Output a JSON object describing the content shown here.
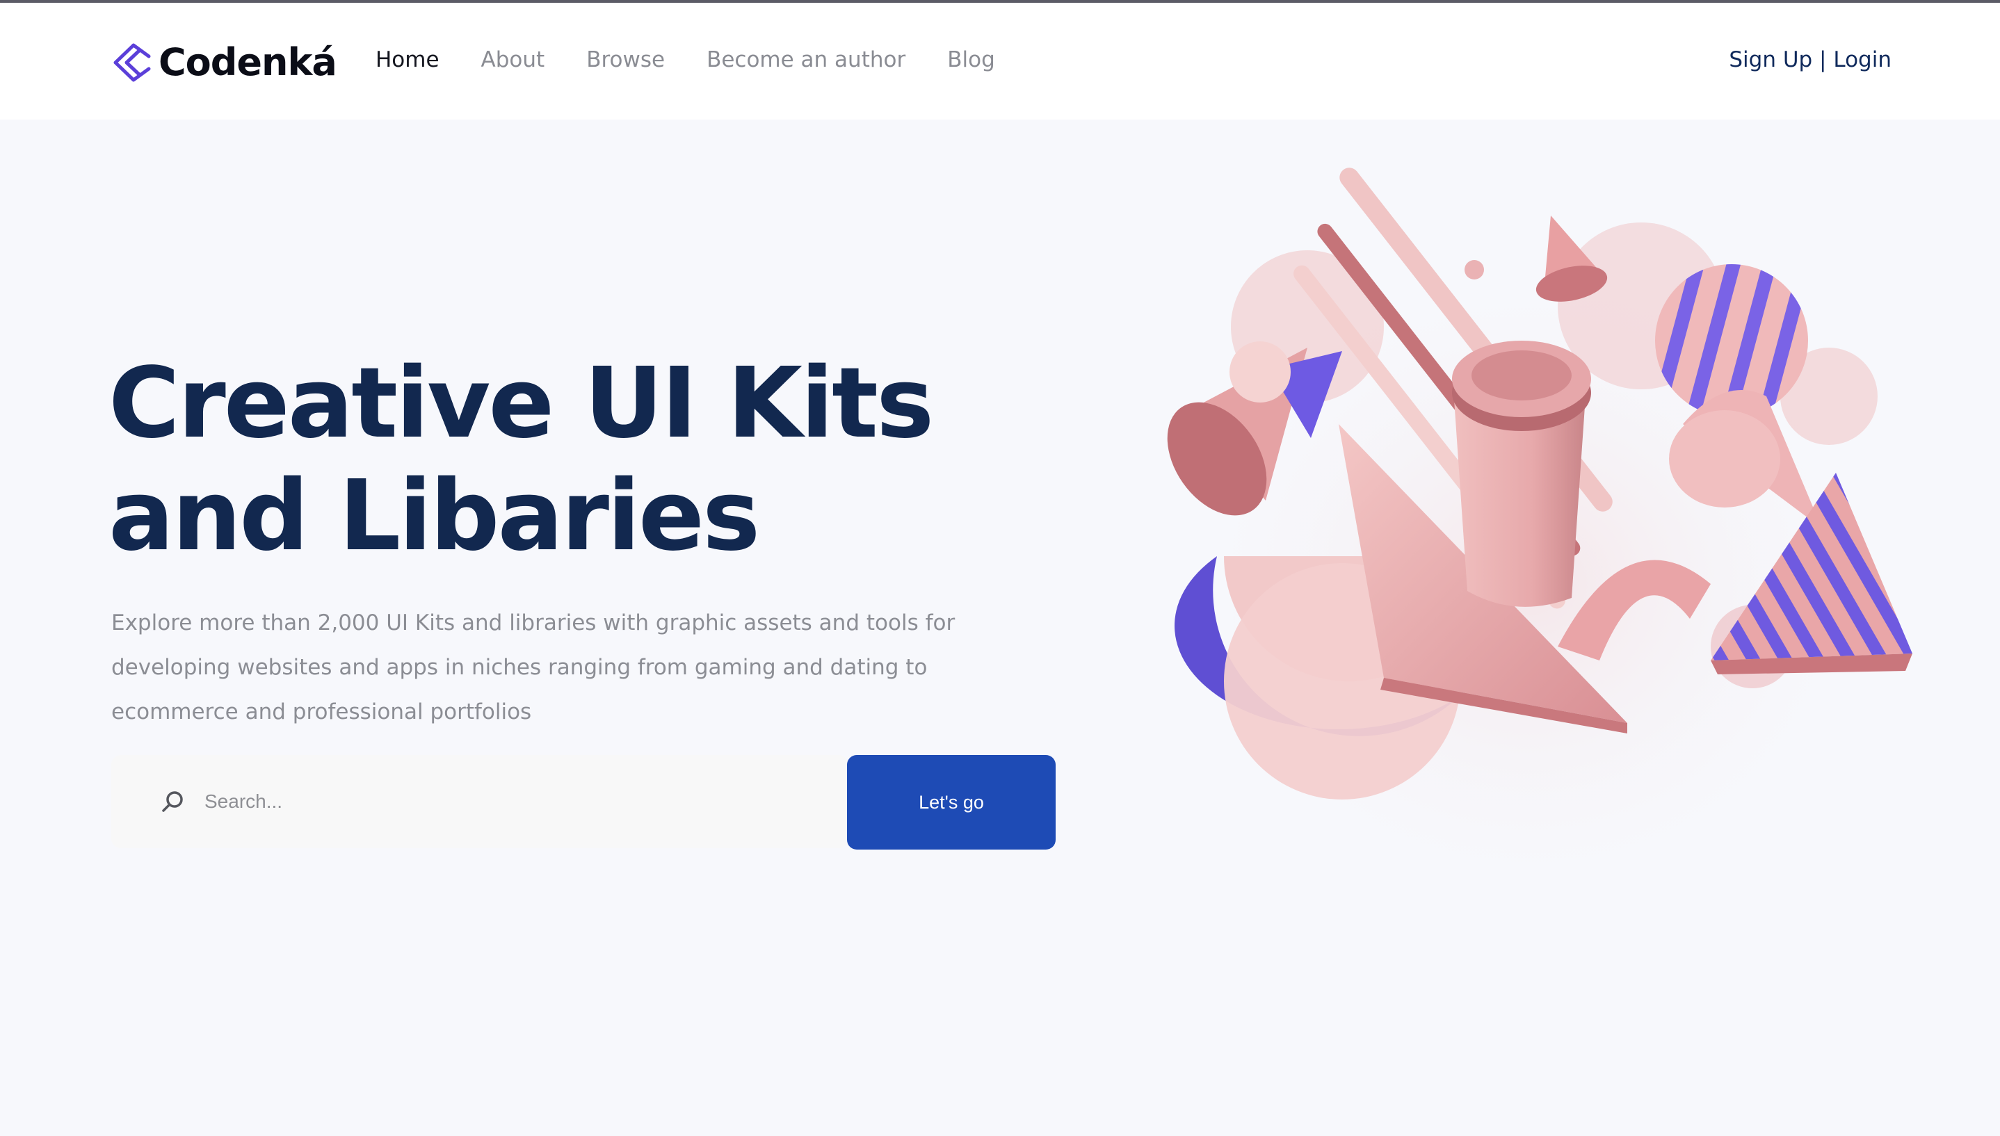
{
  "brand": {
    "name": "Codenká",
    "logo_icon": "codenka-logo-icon"
  },
  "nav": {
    "items": [
      {
        "label": "Home",
        "active": true
      },
      {
        "label": "About",
        "active": false
      },
      {
        "label": "Browse",
        "active": false
      },
      {
        "label": "Become an author",
        "active": false
      },
      {
        "label": "Blog",
        "active": false
      }
    ],
    "signup_label": "Sign Up",
    "separator": " | ",
    "login_label": "Login"
  },
  "hero": {
    "title_line1": "Creative UI Kits",
    "title_line2": "and Libaries",
    "description": "Explore more than 2,000 UI Kits and libraries with graphic assets and tools for developing websites and apps in niches ranging from gaming and dating to ecommerce and professional portfolios",
    "search": {
      "placeholder": "Search...",
      "icon": "search-icon"
    },
    "cta_label": "Let's go"
  },
  "colors": {
    "primary": "#1e4bb5",
    "heading": "#12284f",
    "accent_pink": "#eab3b5",
    "accent_purple": "#6b5ce0",
    "background": "#f7f8fc"
  }
}
